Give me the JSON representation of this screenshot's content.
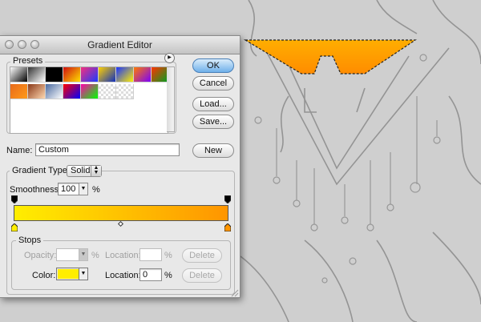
{
  "dialog": {
    "title": "Gradient Editor",
    "presets_label": "Presets",
    "buttons": {
      "ok": "OK",
      "cancel": "Cancel",
      "load": "Load...",
      "save": "Save...",
      "new": "New"
    },
    "name_label": "Name:",
    "name_value": "Custom",
    "gradient_type_label": "Gradient Type:",
    "gradient_type_value": "Solid",
    "smoothness_label": "Smoothness:",
    "smoothness_value": "100",
    "smoothness_unit": "%",
    "stops": {
      "label": "Stops",
      "opacity_label": "Opacity:",
      "opacity_value": "",
      "opacity_unit": "%",
      "opacity_location_label": "Location:",
      "opacity_location_value": "",
      "opacity_location_unit": "%",
      "delete_top": "Delete",
      "color_label": "Color:",
      "color_value": "#ffee00",
      "color_location_label": "Location:",
      "color_location_value": "0",
      "color_location_unit": "%",
      "delete_bottom": "Delete"
    },
    "gradient_colors": {
      "start": "#ffee00",
      "end": "#ff9500"
    },
    "gradient_midpoint": 0.5
  },
  "presets": [
    {
      "a": "#ffffff",
      "b": "#000000"
    },
    {
      "a": "#333333",
      "b": "#ffffff"
    },
    {
      "a": "#000000",
      "b": "#000000"
    },
    {
      "a": "#d01010",
      "b": "#ffe000"
    },
    {
      "a": "#f52e7d",
      "b": "#1a3bff"
    },
    {
      "a": "#ffd000",
      "b": "#1030c0"
    },
    {
      "a": "#1a33ff",
      "b": "#ffee00"
    },
    {
      "a": "#ff7a00",
      "b": "#7a00ff"
    },
    {
      "a": "#ff3300",
      "b": "#00a020"
    },
    {
      "a": "#e86a1a",
      "b": "#ff9a1a"
    },
    {
      "a": "#8b3a1a",
      "b": "#ffd8b0"
    },
    {
      "a": "#4a6aa0",
      "b": "#ffffff"
    },
    {
      "a": "#ff0000",
      "b": "#0000ff"
    },
    {
      "a": "#ff00aa",
      "b": "#00ff00"
    },
    {
      "a": "#eeeeee",
      "b": "#bbbbbb"
    },
    {
      "a": "#eeeeee",
      "b": "#aaaaaa"
    }
  ],
  "accent": {
    "selection_fill_top": "#ffa800",
    "selection_fill_bottom": "#ff8a00"
  }
}
